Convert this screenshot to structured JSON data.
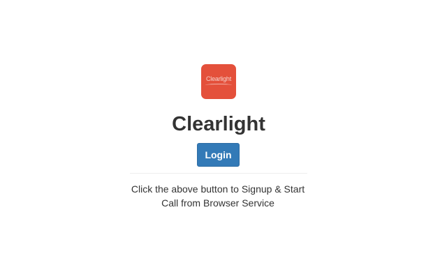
{
  "app": {
    "logo_text": "Clearlight",
    "title": "Clearlight",
    "brand_color": "#e4503b",
    "accent_color": "#337ab7"
  },
  "actions": {
    "login_label": "Login"
  },
  "description": {
    "line1": "Click the above button to Signup & Start",
    "line2": "Call from Browser Service"
  }
}
